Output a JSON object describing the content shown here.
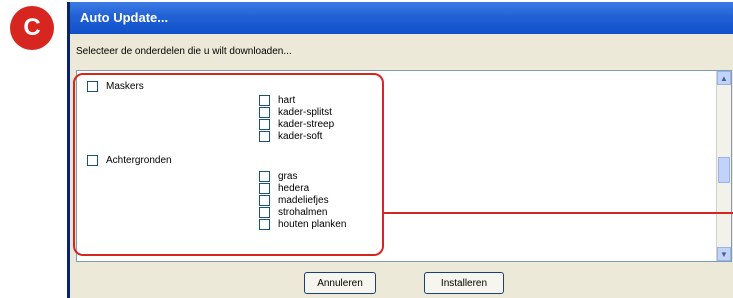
{
  "badge": {
    "label": "C"
  },
  "dialog": {
    "title": "Auto Update...",
    "instruction": "Selecteer de onderdelen die u wilt downloaden...",
    "categories": [
      {
        "label": "Maskers",
        "items": [
          "hart",
          "kader-splitst",
          "kader-streep",
          "kader-soft"
        ]
      },
      {
        "label": "Achtergronden",
        "items": [
          "gras",
          "hedera",
          "madeliefjes",
          "strohalmen",
          "houten planken"
        ]
      }
    ],
    "buttons": {
      "cancel": "Annuleren",
      "install": "Installeren"
    }
  },
  "colors": {
    "accent": "#d7261f",
    "titlebar": "#2463d6"
  }
}
